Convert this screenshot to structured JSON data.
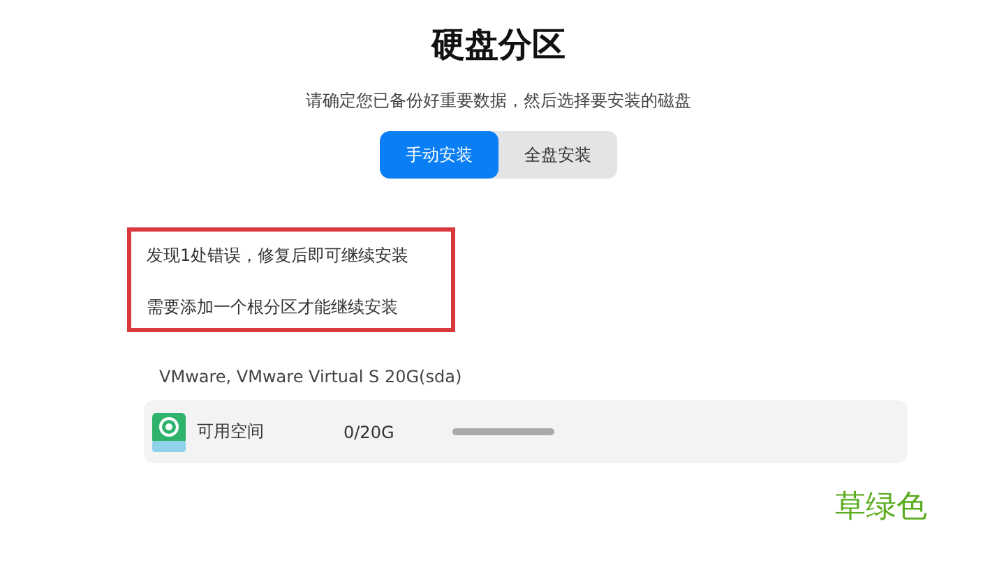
{
  "title": "硬盘分区",
  "subtitle": "请确定您已备份好重要数据，然后选择要安装的磁盘",
  "tabs": [
    {
      "label": "手动安装",
      "selected": true
    },
    {
      "label": "全盘安装",
      "selected": false
    }
  ],
  "errors": [
    "发现1处错误，修复后即可继续安装",
    "需要添加一个根分区才能继续安装"
  ],
  "disk": {
    "name": "VMware, VMware Virtual S 20G(sda)",
    "partitions": [
      {
        "label": "可用空间",
        "size": "0/20G"
      }
    ]
  },
  "annotation": "草绿色"
}
